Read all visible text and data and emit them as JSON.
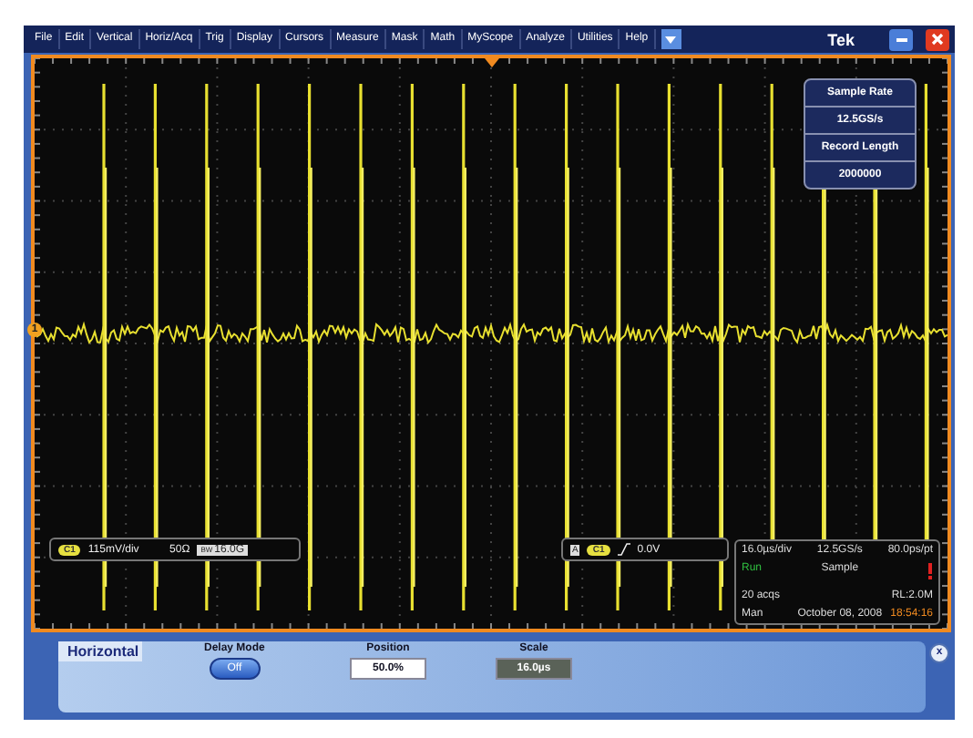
{
  "menu": [
    {
      "label": "File"
    },
    {
      "label": "Edit"
    },
    {
      "label": "Vertical"
    },
    {
      "label": "Horiz/Acq"
    },
    {
      "label": "Trig"
    },
    {
      "label": "Display"
    },
    {
      "label": "Cursors"
    },
    {
      "label": "Measure"
    },
    {
      "label": "Mask"
    },
    {
      "label": "Math"
    },
    {
      "label": "MyScope"
    },
    {
      "label": "Analyze"
    },
    {
      "label": "Utilities"
    },
    {
      "label": "Help"
    }
  ],
  "brand": "Tek",
  "channel_marker": "1",
  "sample_rate": {
    "label": "Sample Rate",
    "value": "12.5GS/s"
  },
  "record_length": {
    "label": "Record Length",
    "value": "2000000"
  },
  "channel_readout": {
    "channel": "C1",
    "scale": "115mV/div",
    "coupling": "50Ω",
    "bw_label": "BW",
    "bandwidth": "16.0G"
  },
  "trigger_readout": {
    "source": "A",
    "channel": "C1",
    "level": "0.0V"
  },
  "acquisition": {
    "horizontal_scale": "16.0µs/div",
    "sample_rate": "12.5GS/s",
    "resolution": "80.0ps/pt",
    "run_state": "Run",
    "mode": "Sample",
    "acqs": "20 acqs",
    "record_length": "RL:2.0M",
    "trigger_mode": "Man",
    "date": "October 08, 2008",
    "time": "18:54:16"
  },
  "panel": {
    "tab": "Horizontal",
    "delay_mode": {
      "label": "Delay Mode",
      "button": "Off"
    },
    "position": {
      "label": "Position",
      "value": "50.0%"
    },
    "scale": {
      "label": "Scale",
      "value": "16.0µs"
    },
    "close": "x"
  }
}
